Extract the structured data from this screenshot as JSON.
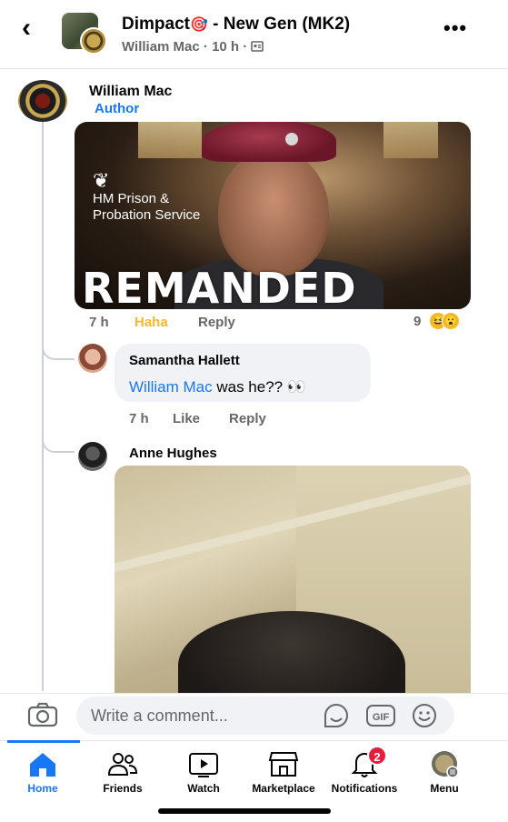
{
  "header": {
    "group_title": "Dimpact",
    "group_title_suffix": " - New Gen (MK2)",
    "title_emoji": "🎯",
    "author": "William Mac",
    "time": "10 h",
    "privacy_icon": "group-privacy-icon"
  },
  "main_comment": {
    "author": "William Mac",
    "badge": "Author",
    "image": {
      "org_line1": "HM Prison &",
      "org_line2": "Probation Service",
      "headline": "REMANDED"
    },
    "time": "7 h",
    "reaction_action": "Haha",
    "reply_label": "Reply",
    "reaction_count": "9",
    "reaction_icons": [
      "haha-reaction-icon",
      "wow-reaction-icon"
    ]
  },
  "replies": [
    {
      "author": "Samantha Hallett",
      "mention": "William Mac",
      "text": " was he?? 👀",
      "time": "7 h",
      "like_label": "Like",
      "reply_label": "Reply"
    },
    {
      "author": "Anne Hughes"
    }
  ],
  "composer": {
    "placeholder": "Write a comment..."
  },
  "nav": {
    "items": [
      {
        "label": "Home",
        "icon": "home-icon",
        "active": true
      },
      {
        "label": "Friends",
        "icon": "friends-icon"
      },
      {
        "label": "Watch",
        "icon": "watch-icon"
      },
      {
        "label": "Marketplace",
        "icon": "marketplace-icon"
      },
      {
        "label": "Notifications",
        "icon": "bell-icon",
        "badge": "2"
      },
      {
        "label": "Menu",
        "icon": "menu-avatar-icon"
      }
    ]
  },
  "colors": {
    "accent": "#1877f2",
    "haha": "#f7b928",
    "badge": "#e41e3f"
  }
}
